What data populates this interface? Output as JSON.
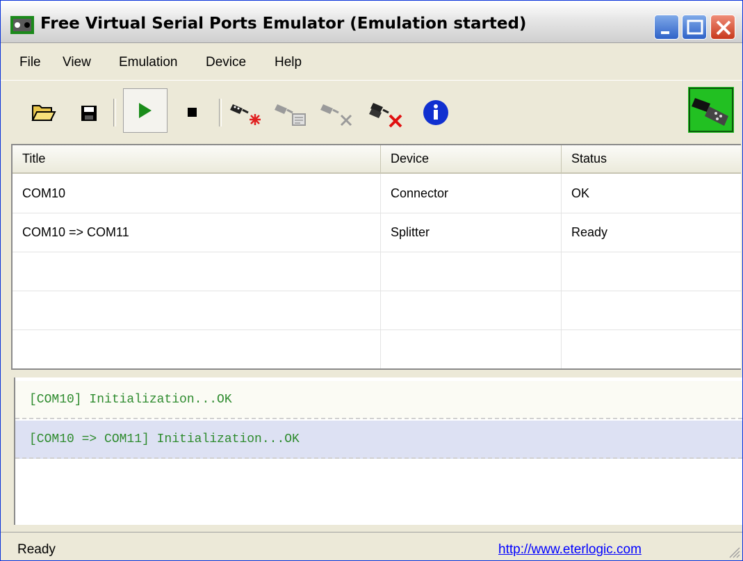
{
  "window": {
    "title": "Free Virtual Serial Ports Emulator (Emulation started)"
  },
  "menu": [
    "File",
    "View",
    "Emulation",
    "Device",
    "Help"
  ],
  "toolbar": {
    "buttons": [
      "open-folder-icon",
      "save-icon",
      "start-emulation-icon",
      "stop-emulation-icon",
      "new-device-icon",
      "device-properties-icon",
      "delete-device-icon",
      "delete-all-devices-icon",
      "info-icon"
    ]
  },
  "table": {
    "columns": [
      "Title",
      "Device",
      "Status"
    ],
    "rows": [
      {
        "title": "COM10",
        "device": "Connector",
        "status": "OK"
      },
      {
        "title": "COM10 => COM11",
        "device": "Splitter",
        "status": "Ready"
      }
    ]
  },
  "log": [
    "[COM10] Initialization...OK",
    "[COM10 => COM11] Initialization...OK"
  ],
  "status": {
    "text": "Ready",
    "link": "http://www.eterlogic.com"
  },
  "colors": {
    "log_text": "#2e8b2e",
    "link": "#0000ff",
    "selection": "#dde1f3"
  }
}
